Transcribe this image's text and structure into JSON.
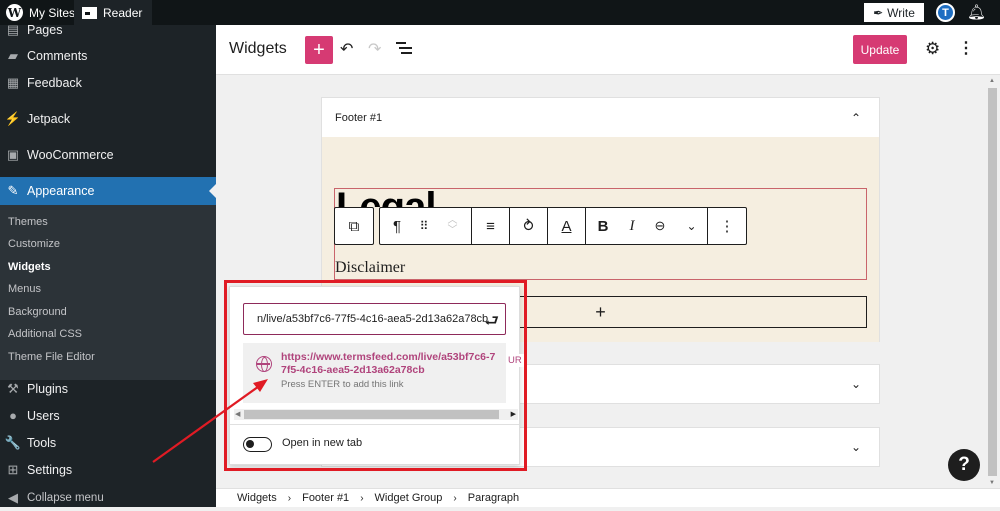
{
  "topbar": {
    "my_sites": "My Sites",
    "reader": "Reader",
    "write": "Write",
    "avatar_initial": "T",
    "icons": {
      "logo": "wordpress-logo",
      "reader": "reader-icon",
      "write": "feather-icon",
      "notifications": "bell-icon"
    }
  },
  "sidebar": {
    "items": [
      {
        "label": "Pages",
        "icon": "pages-icon",
        "glyph": "▤"
      },
      {
        "label": "Comments",
        "icon": "comment-icon",
        "glyph": "▰"
      },
      {
        "label": "Feedback",
        "icon": "feedback-icon",
        "glyph": "▦"
      },
      {
        "label": "Jetpack",
        "icon": "jetpack-icon",
        "glyph": "⚡"
      },
      {
        "label": "WooCommerce",
        "icon": "woocommerce-icon",
        "glyph": "▣"
      },
      {
        "label": "Appearance",
        "icon": "paintbrush-icon",
        "glyph": "✎",
        "active": true
      }
    ],
    "submenu": [
      {
        "label": "Themes"
      },
      {
        "label": "Customize"
      },
      {
        "label": "Widgets",
        "current": true
      },
      {
        "label": "Menus"
      },
      {
        "label": "Background"
      },
      {
        "label": "Additional CSS"
      },
      {
        "label": "Theme File Editor"
      }
    ],
    "lower_items": [
      {
        "label": "Plugins",
        "icon": "plugin-icon",
        "glyph": "⚒"
      },
      {
        "label": "Users",
        "icon": "user-icon",
        "glyph": "●"
      },
      {
        "label": "Tools",
        "icon": "wrench-icon",
        "glyph": "🔧"
      },
      {
        "label": "Settings",
        "icon": "settings-icon",
        "glyph": "⊞"
      },
      {
        "label": "Collapse menu",
        "icon": "collapse-icon",
        "glyph": "◀"
      }
    ]
  },
  "header": {
    "title": "Widgets",
    "add_label": "+",
    "undo_glyph": "↶",
    "redo_glyph": "↷",
    "update_label": "Update",
    "gear_glyph": "⚙",
    "more_glyph": "⋮"
  },
  "editor": {
    "footer1": {
      "title": "Footer #1",
      "chevron": "⌃",
      "heading": "Legal",
      "paragraph": "Disclaimer",
      "appender": "+"
    },
    "collapsed_panels": [
      {
        "chevron": "⌄"
      },
      {
        "chevron": "⌄"
      }
    ],
    "toolbar": {
      "group_glyph": "⧉",
      "paragraph_glyph": "¶",
      "drag_glyph": "⠿",
      "move_up": "︿",
      "move_down": "﹀",
      "align_glyph": "≡",
      "transform_glyph": "⥁",
      "color_glyph": "A",
      "bold_glyph": "B",
      "italic_glyph": "I",
      "link_glyph": "⊖",
      "more_rich_glyph": "⌄",
      "options_glyph": "⋮"
    }
  },
  "link_popover": {
    "input_value": "n/live/a53bf7c6-77f5-4c16-aea5-2d13a62a78cb",
    "submit_glyph": "⮐",
    "suggestion": {
      "url": "https://www.termsfeed.com/live/a53bf7c6-77f5-4c16-aea5-2d13a62a78cb",
      "hint": "Press ENTER to add this link",
      "type_tag": "UR"
    },
    "open_new_tab_label": "Open in new tab",
    "open_new_tab_checked": false
  },
  "breadcrumb": [
    "Widgets",
    "Footer #1",
    "Widget Group",
    "Paragraph"
  ],
  "help_glyph": "?",
  "colors": {
    "accent": "#d63a73",
    "admin_blue": "#2271b1",
    "sidebar_bg": "#1d2327",
    "link_color": "#b0447c",
    "annotation_red": "#e01b24",
    "footer_bg": "#f5eee0"
  }
}
